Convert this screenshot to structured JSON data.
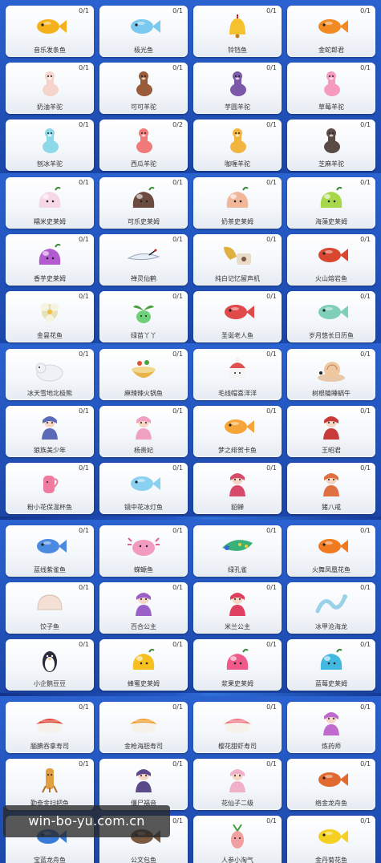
{
  "accent_colors": {
    "background": "#1b46a8",
    "card": "#ffffff"
  },
  "watermark": "win-bo-yu.com.cn",
  "items": [
    {
      "name": "音乐发条鱼",
      "count": "0/1",
      "icon": "fish-icon",
      "color": "#f3b21c"
    },
    {
      "name": "极光鱼",
      "count": "0/1",
      "icon": "fish-icon",
      "color": "#7cc9ef"
    },
    {
      "name": "铃铛鱼",
      "count": "0/1",
      "icon": "bell-fish-icon",
      "color": "#f5c22d"
    },
    {
      "name": "金蛇郎君",
      "count": "0/1",
      "icon": "fish-icon",
      "color": "#f28a24"
    },
    {
      "name": "奶油羊驼",
      "count": "0/1",
      "icon": "alpaca-icon",
      "color": "#f4d4cb"
    },
    {
      "name": "可可羊驼",
      "count": "0/1",
      "icon": "alpaca-icon",
      "color": "#9a5b3a"
    },
    {
      "name": "芋圆羊驼",
      "count": "0/1",
      "icon": "alpaca-icon",
      "color": "#7a5aa8"
    },
    {
      "name": "草莓羊驼",
      "count": "0/1",
      "icon": "alpaca-icon",
      "color": "#f59ac0"
    },
    {
      "name": "刨冰羊驼",
      "count": "0/1",
      "icon": "alpaca-icon",
      "color": "#8ed8e8"
    },
    {
      "name": "西瓜羊驼",
      "count": "0/2",
      "icon": "alpaca-icon",
      "color": "#f07a7a"
    },
    {
      "name": "咖喱羊驼",
      "count": "0/1",
      "icon": "alpaca-icon",
      "color": "#f2b640"
    },
    {
      "name": "芝麻羊驼",
      "count": "0/1",
      "icon": "alpaca-icon",
      "color": "#5b4a45"
    },
    {
      "name": "糯米史莱姆",
      "count": "0/1",
      "icon": "slime-icon",
      "color": "#f6d8e4"
    },
    {
      "name": "可乐史莱姆",
      "count": "0/1",
      "icon": "slime-icon",
      "color": "#6b4a40"
    },
    {
      "name": "奶茶史莱姆",
      "count": "0/1",
      "icon": "slime-icon",
      "color": "#f1b79a"
    },
    {
      "name": "海藻史莱姆",
      "count": "0/1",
      "icon": "slime-icon",
      "color": "#a8d84a"
    },
    {
      "name": "香芋史莱姆",
      "count": "0/1",
      "icon": "slime-icon",
      "color": "#b45ad0"
    },
    {
      "name": "禅灵仙鹤",
      "count": "0/1",
      "icon": "crane-icon",
      "color": "#e8eef8"
    },
    {
      "name": "纯白记忆留声机",
      "count": "0/1",
      "icon": "gramophone-icon",
      "color": "#e0b040"
    },
    {
      "name": "火山熔岩鱼",
      "count": "0/1",
      "icon": "fish-icon",
      "color": "#d9472f"
    },
    {
      "name": "金昙花鱼",
      "count": "0/1",
      "icon": "flower-fish-icon",
      "color": "#e6e2b8"
    },
    {
      "name": "绿苗丫丫",
      "count": "0/1",
      "icon": "sprout-icon",
      "color": "#6ed07a"
    },
    {
      "name": "圣诞老人鱼",
      "count": "0/1",
      "icon": "fish-icon",
      "color": "#e04a4a"
    },
    {
      "name": "岁月悠长日历鱼",
      "count": "0/1",
      "icon": "fish-icon",
      "color": "#7fd0b8"
    },
    {
      "name": "冰天雪地北极熊",
      "count": "0/1",
      "icon": "bear-icon",
      "color": "#eef2f6"
    },
    {
      "name": "麻辣辣火锅鱼",
      "count": "0/1",
      "icon": "hotpot-icon",
      "color": "#e8b44a"
    },
    {
      "name": "毛线帽喜洋洋",
      "count": "0/1",
      "icon": "sheep-icon",
      "color": "#e05050"
    },
    {
      "name": "树根瞌睡蜗牛",
      "count": "0/1",
      "icon": "snail-icon",
      "color": "#f0c8a0"
    },
    {
      "name": "狼族美少年",
      "count": "0/1",
      "icon": "character-icon",
      "color": "#5a6ab8"
    },
    {
      "name": "杨贵妃",
      "count": "0/1",
      "icon": "character-icon",
      "color": "#f0a0c0"
    },
    {
      "name": "梦之绯贺卡鱼",
      "count": "0/1",
      "icon": "fish-icon",
      "color": "#f5a53a"
    },
    {
      "name": "王昭君",
      "count": "0/1",
      "icon": "character-icon",
      "color": "#c83a3a"
    },
    {
      "name": "粉小花保温杯鱼",
      "count": "0/1",
      "icon": "cup-fish-icon",
      "color": "#f07aa0"
    },
    {
      "name": "镜中花冰灯鱼",
      "count": "0/1",
      "icon": "fish-icon",
      "color": "#8ad0f0"
    },
    {
      "name": "貂蝉",
      "count": "0/1",
      "icon": "character-icon",
      "color": "#d84a6a"
    },
    {
      "name": "猪八戒",
      "count": "0/1",
      "icon": "character-icon",
      "color": "#e07040"
    },
    {
      "name": "蓝线紫雀鱼",
      "count": "0/1",
      "icon": "fish-icon",
      "color": "#4a8ae0"
    },
    {
      "name": "蝾螈鱼",
      "count": "0/1",
      "icon": "axolotl-icon",
      "color": "#f29ac0"
    },
    {
      "name": "绿孔雀",
      "count": "0/1",
      "icon": "peacock-icon",
      "color": "#3ab07a"
    },
    {
      "name": "火舞凤凰花鱼",
      "count": "0/1",
      "icon": "fish-icon",
      "color": "#f07a20"
    },
    {
      "name": "饺子鱼",
      "count": "0/1",
      "icon": "dumpling-icon",
      "color": "#f4e0d4"
    },
    {
      "name": "百合公主",
      "count": "0/1",
      "icon": "character-icon",
      "color": "#9a60c8"
    },
    {
      "name": "米兰公主",
      "count": "0/1",
      "icon": "character-icon",
      "color": "#e04060"
    },
    {
      "name": "冰甲沧海龙",
      "count": "0/1",
      "icon": "dragon-icon",
      "color": "#9ad0e8"
    },
    {
      "name": "小企鹅豆豆",
      "count": "0/1",
      "icon": "penguin-icon",
      "color": "#2a2a3a"
    },
    {
      "name": "蜂蜜史莱姆",
      "count": "0/1",
      "icon": "slime-icon",
      "color": "#f5c020"
    },
    {
      "name": "浆果史莱姆",
      "count": "0/1",
      "icon": "slime-icon",
      "color": "#f05a8a"
    },
    {
      "name": "蓝莓史莱姆",
      "count": "0/1",
      "icon": "slime-icon",
      "color": "#40b8e0"
    },
    {
      "name": "腼腆吞拿寿司",
      "count": "0/1",
      "icon": "sushi-icon",
      "color": "#e04a3a"
    },
    {
      "name": "金枪海胆寿司",
      "count": "0/1",
      "icon": "sushi-icon",
      "color": "#f0a030"
    },
    {
      "name": "樱花甜虾寿司",
      "count": "0/1",
      "icon": "sushi-icon",
      "color": "#f07a8a"
    },
    {
      "name": "炼药师",
      "count": "0/1",
      "icon": "character-icon",
      "color": "#c06ad0"
    },
    {
      "name": "勤奋金扫把鱼",
      "count": "0/1",
      "icon": "broom-fish-icon",
      "color": "#e0a040"
    },
    {
      "name": "僵尸福音",
      "count": "0/1",
      "icon": "character-icon",
      "color": "#5a4a8a"
    },
    {
      "name": "花仙子二级",
      "count": "0/1",
      "icon": "character-icon",
      "color": "#f0b0c8"
    },
    {
      "name": "络金龙舟鱼",
      "count": "0/1",
      "icon": "fish-icon",
      "color": "#e06a30"
    },
    {
      "name": "宝蓝龙舟鱼",
      "count": "0/1",
      "icon": "fish-icon",
      "color": "#3a7ad8"
    },
    {
      "name": "公文包鱼",
      "count": "0/1",
      "icon": "fish-icon",
      "color": "#7a5a40"
    },
    {
      "name": "人参小淘气",
      "count": "0/1",
      "icon": "ginseng-icon",
      "color": "#f0a0a0"
    },
    {
      "name": "金丹菊花鱼",
      "count": "0/1",
      "icon": "fish-icon",
      "color": "#f5d020"
    }
  ]
}
